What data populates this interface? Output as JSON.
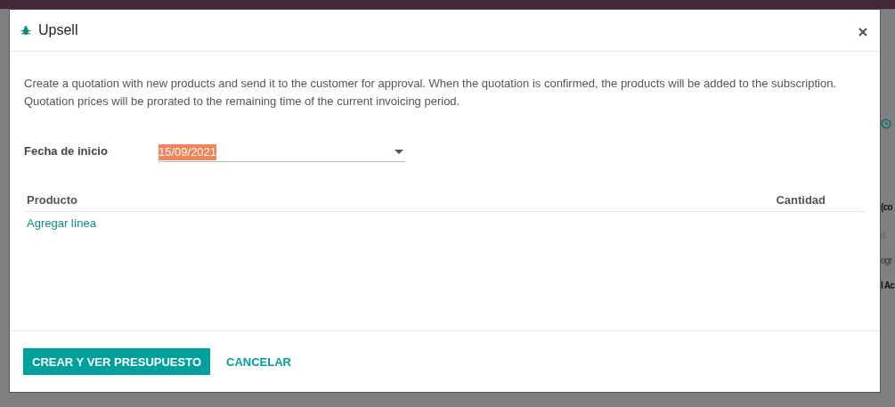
{
  "backdrop": {
    "fragments": [
      {
        "kind": "icon"
      },
      {
        "kind": "bold",
        "text": "(co"
      },
      {
        "kind": "accent",
        "text": "d"
      },
      {
        "kind": "plain",
        "text": "ogr"
      },
      {
        "kind": "bold",
        "text": "l Ac"
      }
    ]
  },
  "dialog": {
    "title": "Upsell",
    "description": "Create a quotation with new products and send it to the customer for approval. When the quotation is confirmed, the products will be added to the subscription. Quotation prices will be prorated to the remaining time of the current invoicing period.",
    "start_date": {
      "label": "Fecha de inicio",
      "value": "15/09/2021",
      "highlighted": true
    },
    "table": {
      "columns": [
        "Producto",
        "Cantidad"
      ],
      "add_line": "Agregar línea"
    },
    "buttons": [
      {
        "label": "CREAR Y VER PRESUPUESTO",
        "kind": "primary"
      },
      {
        "label": "CANCELAR",
        "kind": "link"
      }
    ]
  }
}
